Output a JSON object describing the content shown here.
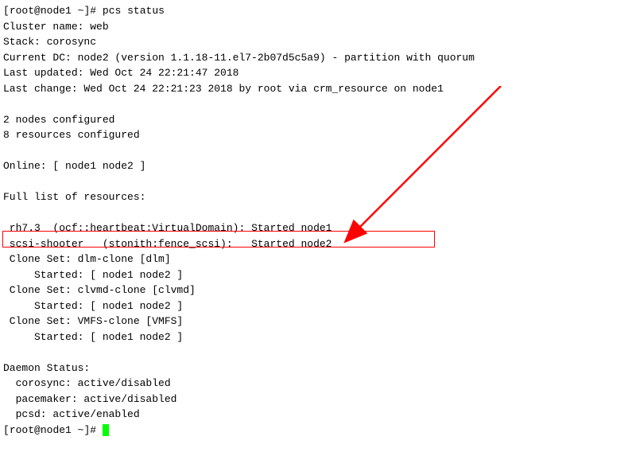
{
  "prompt": {
    "user": "root",
    "host": "node1",
    "path": "~",
    "symbol": "#"
  },
  "command": "pcs status",
  "output": {
    "cluster_name_label": "Cluster name:",
    "cluster_name": "web",
    "stack_label": "Stack:",
    "stack": "corosync",
    "current_dc_line": "Current DC: node2 (version 1.1.18-11.el7-2b07d5c5a9) - partition with quorum",
    "last_updated_line": "Last updated: Wed Oct 24 22:21:47 2018",
    "last_change_line": "Last change: Wed Oct 24 22:21:23 2018 by root via crm_resource on node1",
    "nodes_configured": "2 nodes configured",
    "resources_configured": "8 resources configured",
    "online_line": "Online: [ node1 node2 ]",
    "resources_header": "Full list of resources:",
    "resources": {
      "rh73_line": " rh7.3\t(ocf::heartbeat:VirtualDomain):\tStarted node1",
      "scsi_line": " scsi-shooter\t(stonith:fence_scsi):\tStarted node2",
      "dlm_clone_header": " Clone Set: dlm-clone [dlm]",
      "dlm_clone_started": "     Started: [ node1 node2 ]",
      "clvmd_clone_header": " Clone Set: clvmd-clone [clvmd]",
      "clvmd_clone_started": "     Started: [ node1 node2 ]",
      "vmfs_clone_header": " Clone Set: VMFS-clone [VMFS]",
      "vmfs_clone_started": "     Started: [ node1 node2 ]"
    },
    "daemon_header": "Daemon Status:",
    "daemons": {
      "corosync": "  corosync: active/disabled",
      "pacemaker": "  pacemaker: active/disabled",
      "pcsd": "  pcsd: active/enabled"
    }
  },
  "annotation": {
    "highlight_color": "#ff0000",
    "arrow_color": "#ff0000"
  }
}
